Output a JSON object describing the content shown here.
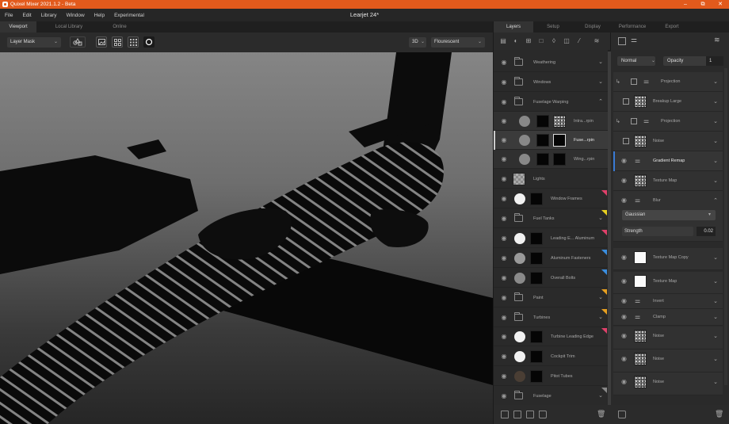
{
  "app": {
    "title": "Quixel Mixer 2021.1.2 - Beta",
    "document": "Learjet 24*"
  },
  "menu": [
    "File",
    "Edit",
    "Library",
    "Window",
    "Help",
    "Experimental"
  ],
  "window_controls": {
    "minimize": "–",
    "maximize": "⧉",
    "close": "✕"
  },
  "viewport_tabs": [
    "Viewport",
    "Local Library",
    "Online"
  ],
  "viewport_toolbar": {
    "mask_mode": "Layer Mask",
    "view_mode": "3D",
    "lighting": "Flourescent"
  },
  "right_tabs": [
    "Layers",
    "Setup",
    "Display",
    "Performance",
    "Export"
  ],
  "layers": [
    {
      "name": "Weathering",
      "kind": "folder",
      "chevron": "⌄"
    },
    {
      "name": "Windows",
      "kind": "folder",
      "chevron": "⌄"
    },
    {
      "name": "Fuselage Warping",
      "kind": "folder",
      "chevron": "⌃"
    },
    {
      "name": "Intra...rpin",
      "kind": "child"
    },
    {
      "name": "Fuse...rpin",
      "kind": "child-selected"
    },
    {
      "name": "Wing...rpin",
      "kind": "child"
    },
    {
      "name": "Lights",
      "kind": "checker"
    },
    {
      "name": "Window Frames",
      "kind": "solid",
      "tag": "#e0406a"
    },
    {
      "name": "Fuel Tanks",
      "kind": "folder",
      "chevron": "⌄",
      "tag": "#e8d020"
    },
    {
      "name": "Leading E... Aluminum",
      "kind": "solid",
      "tag": "#e0406a"
    },
    {
      "name": "Aluminum Fasteners",
      "kind": "grey",
      "tag": "#3a8ee0"
    },
    {
      "name": "Overall Bolts",
      "kind": "grey",
      "tag": "#3a8ee0"
    },
    {
      "name": "Paint",
      "kind": "folder",
      "chevron": "⌄",
      "tag": "#e8a020"
    },
    {
      "name": "Turbines",
      "kind": "folder",
      "chevron": "⌄",
      "tag": "#e8a020"
    },
    {
      "name": "Turbine Leading Edge",
      "kind": "solid",
      "tag": "#e0406a"
    },
    {
      "name": "Cockpit Trim",
      "kind": "solid"
    },
    {
      "name": "Pitot Tubes",
      "kind": "brown"
    },
    {
      "name": "Fuselage",
      "kind": "folder",
      "chevron": "⌄",
      "tag": "#888888"
    }
  ],
  "properties": {
    "blend_mode": "Normal",
    "opacity_label": "Opacity",
    "opacity_value": "1",
    "stack": [
      {
        "name": "Projection",
        "kind": "projection"
      },
      {
        "name": "Breakup Large",
        "kind": "noise-check"
      },
      {
        "name": "Projection",
        "kind": "projection"
      },
      {
        "name": "Noise",
        "kind": "noise-check"
      },
      {
        "name": "Gradient Remap",
        "kind": "adjust-highlight"
      },
      {
        "name": "Texture Map",
        "kind": "noise"
      },
      {
        "name": "Blur",
        "kind": "adjust-open"
      }
    ],
    "blur": {
      "type": "Gaussian",
      "strength_label": "Strength",
      "strength_value": "0.02"
    },
    "stack2": [
      {
        "name": "Texture Map Copy",
        "kind": "white"
      },
      {
        "name": "Texture Map",
        "kind": "white"
      },
      {
        "name": "Invert",
        "kind": "adjust"
      },
      {
        "name": "Clamp",
        "kind": "adjust"
      },
      {
        "name": "Noise",
        "kind": "noise"
      },
      {
        "name": "Noise",
        "kind": "noise"
      },
      {
        "name": "Noise",
        "kind": "noise"
      }
    ]
  }
}
